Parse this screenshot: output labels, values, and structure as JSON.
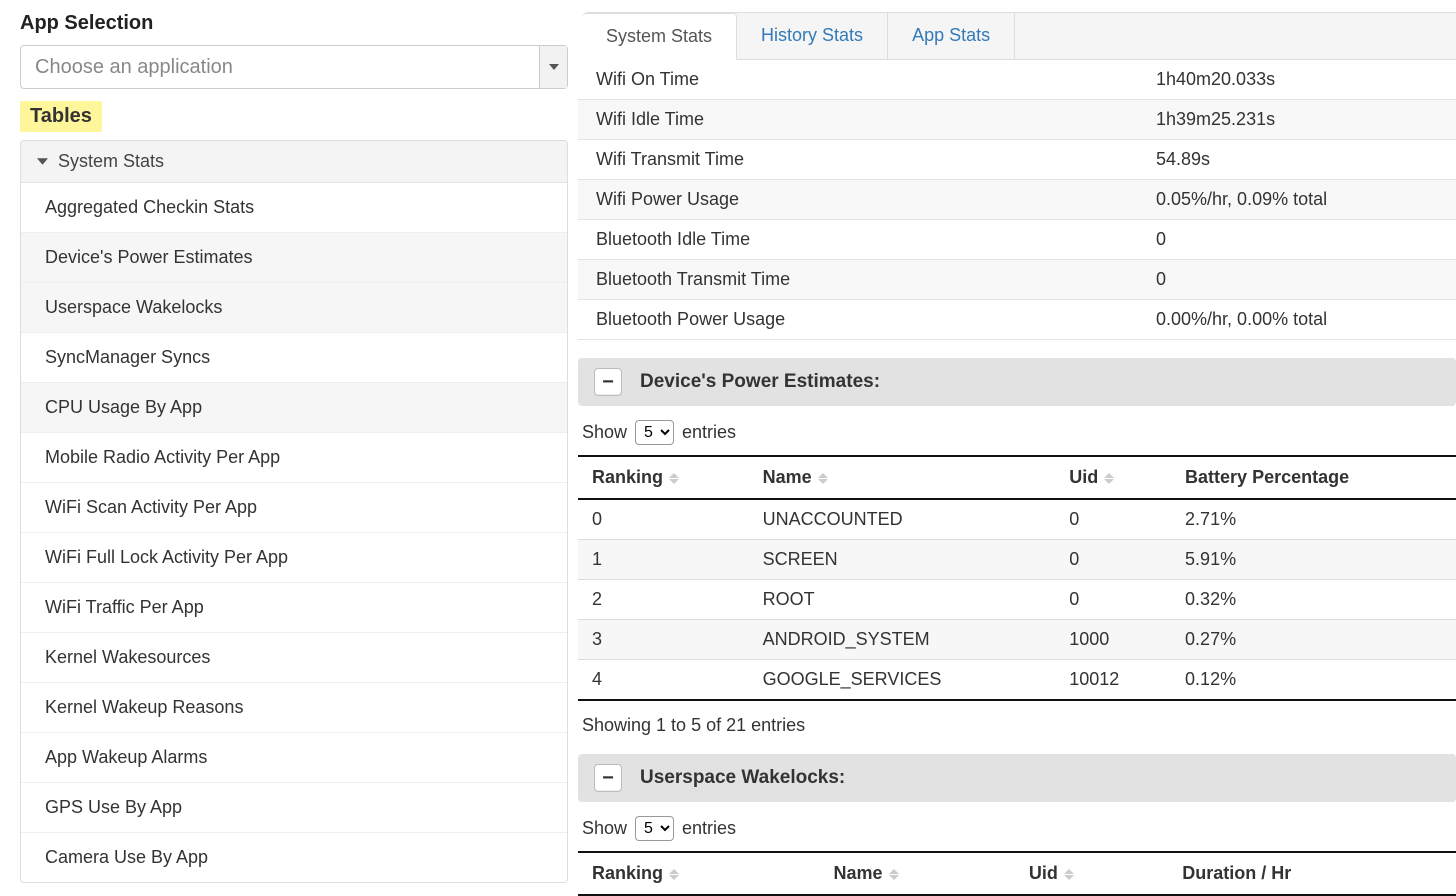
{
  "left": {
    "app_selection_title": "App Selection",
    "app_select_placeholder": "Choose an application",
    "tables_label": "Tables",
    "sidebar_header": "System Stats",
    "sidebar_items": [
      {
        "label": "Aggregated Checkin Stats",
        "shaded": false
      },
      {
        "label": "Device's Power Estimates",
        "shaded": true
      },
      {
        "label": "Userspace Wakelocks",
        "shaded": true
      },
      {
        "label": "SyncManager Syncs",
        "shaded": false
      },
      {
        "label": "CPU Usage By App",
        "shaded": true
      },
      {
        "label": "Mobile Radio Activity Per App",
        "shaded": false
      },
      {
        "label": "WiFi Scan Activity Per App",
        "shaded": false
      },
      {
        "label": "WiFi Full Lock Activity Per App",
        "shaded": false
      },
      {
        "label": "WiFi Traffic Per App",
        "shaded": false
      },
      {
        "label": "Kernel Wakesources",
        "shaded": false
      },
      {
        "label": "Kernel Wakeup Reasons",
        "shaded": false
      },
      {
        "label": "App Wakeup Alarms",
        "shaded": false
      },
      {
        "label": "GPS Use By App",
        "shaded": false
      },
      {
        "label": "Camera Use By App",
        "shaded": false
      }
    ]
  },
  "tabs": [
    {
      "label": "System Stats",
      "active": true
    },
    {
      "label": "History Stats",
      "active": false
    },
    {
      "label": "App Stats",
      "active": false
    }
  ],
  "system_stats_rows": [
    {
      "metric": "Wifi On Time",
      "value": "1h40m20.033s"
    },
    {
      "metric": "Wifi Idle Time",
      "value": "1h39m25.231s"
    },
    {
      "metric": "Wifi Transmit Time",
      "value": "54.89s"
    },
    {
      "metric": "Wifi Power Usage",
      "value": "0.05%/hr, 0.09% total"
    },
    {
      "metric": "Bluetooth Idle Time",
      "value": "0"
    },
    {
      "metric": "Bluetooth Transmit Time",
      "value": "0"
    },
    {
      "metric": "Bluetooth Power Usage",
      "value": "0.00%/hr, 0.00% total"
    }
  ],
  "power_estimates": {
    "title": "Device's Power Estimates:",
    "collapse_icon": "−",
    "show_label_pre": "Show",
    "show_value": "5",
    "show_label_post": "entries",
    "columns": [
      "Ranking",
      "Name",
      "Uid",
      "Battery Percentage"
    ],
    "rows": [
      {
        "ranking": "0",
        "name": "UNACCOUNTED",
        "uid": "0",
        "pct": "2.71%"
      },
      {
        "ranking": "1",
        "name": "SCREEN",
        "uid": "0",
        "pct": "5.91%"
      },
      {
        "ranking": "2",
        "name": "ROOT",
        "uid": "0",
        "pct": "0.32%"
      },
      {
        "ranking": "3",
        "name": "ANDROID_SYSTEM",
        "uid": "1000",
        "pct": "0.27%"
      },
      {
        "ranking": "4",
        "name": "GOOGLE_SERVICES",
        "uid": "10012",
        "pct": "0.12%"
      }
    ],
    "info": "Showing 1 to 5 of 21 entries"
  },
  "wakelocks": {
    "title": "Userspace Wakelocks:",
    "collapse_icon": "−",
    "show_label_pre": "Show",
    "show_value": "5",
    "show_label_post": "entries",
    "columns": [
      "Ranking",
      "Name",
      "Uid",
      "Duration / Hr"
    ]
  }
}
